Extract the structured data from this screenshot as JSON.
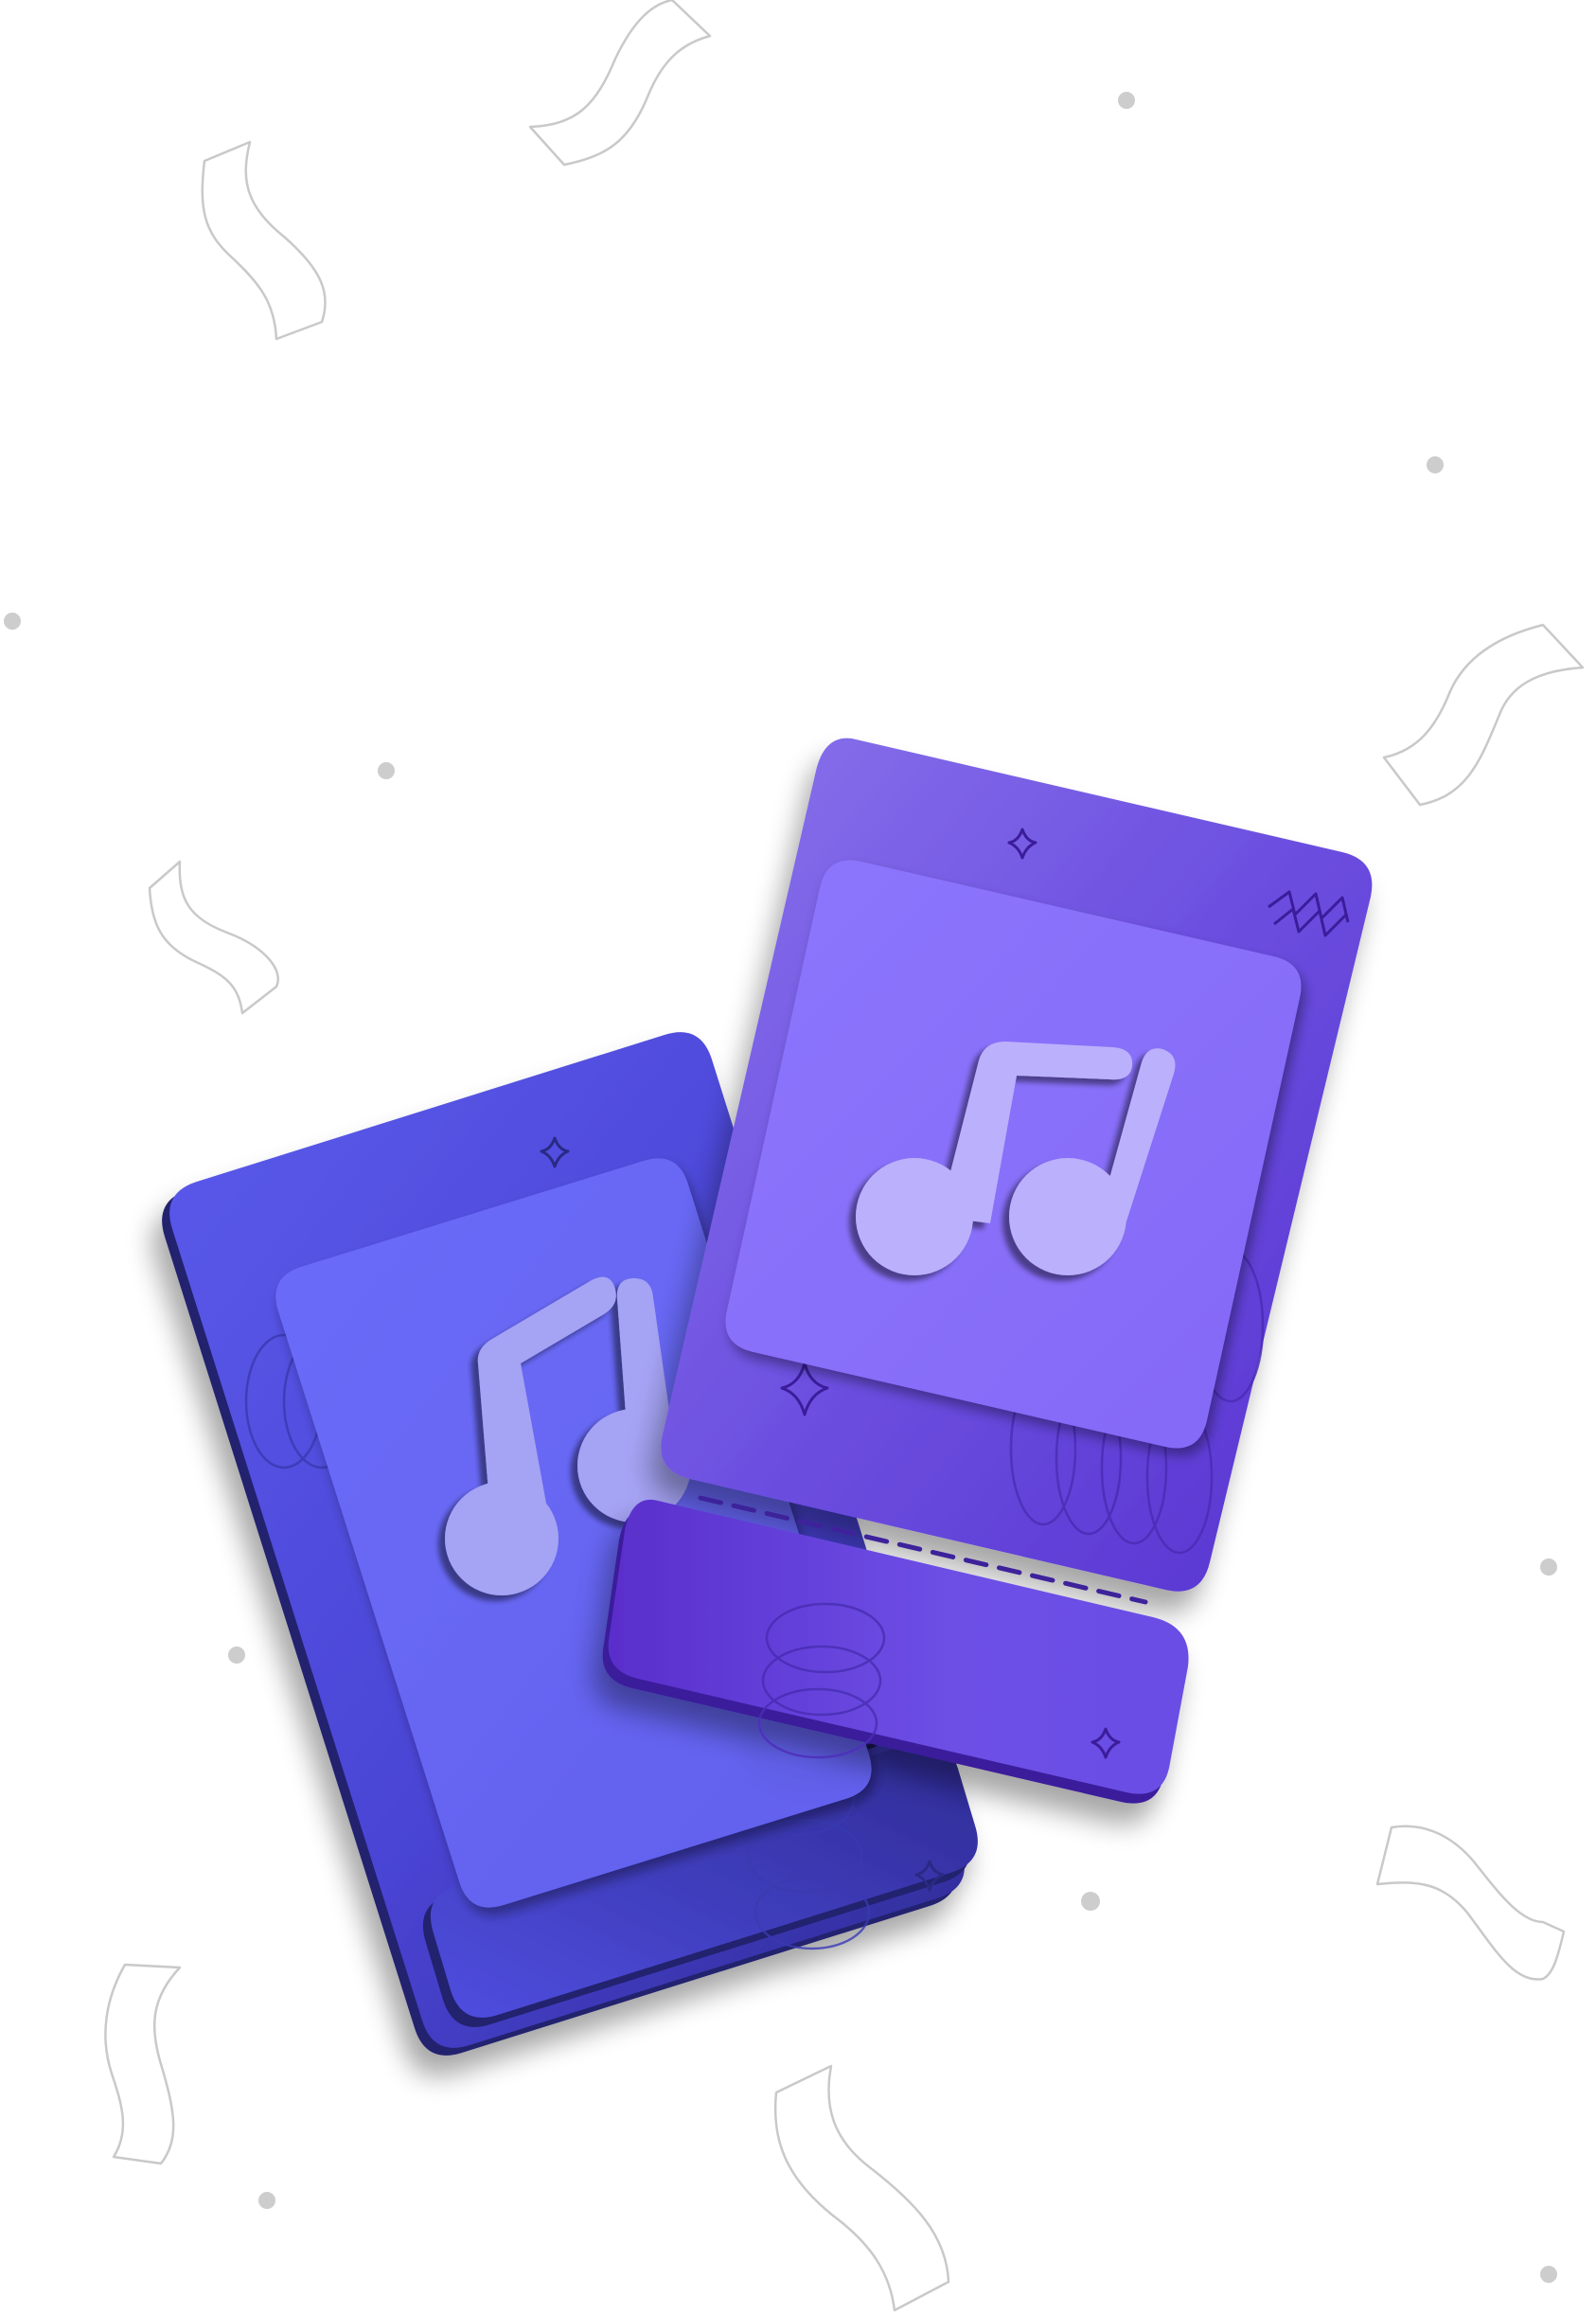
{
  "scene": {
    "description_icon": "music-ticket-illustration",
    "background_color": "#ffffff",
    "colors": {
      "back_ticket_light": "#5b5bec",
      "back_ticket_dark": "#2e2a93",
      "back_panel": "#6a6cf6",
      "back_note": "#a5a3f3",
      "front_ticket_light": "#8470eb",
      "front_ticket_dark": "#5632cf",
      "front_panel": "#8a72fb",
      "front_note": "#bbb0fb",
      "confetti_stroke": "#c9c9c9",
      "dot": "#cdcdcd"
    },
    "tickets": [
      {
        "name": "back-ticket",
        "icon": "music-note-icon"
      },
      {
        "name": "front-ticket",
        "icon": "music-note-icon"
      }
    ]
  }
}
